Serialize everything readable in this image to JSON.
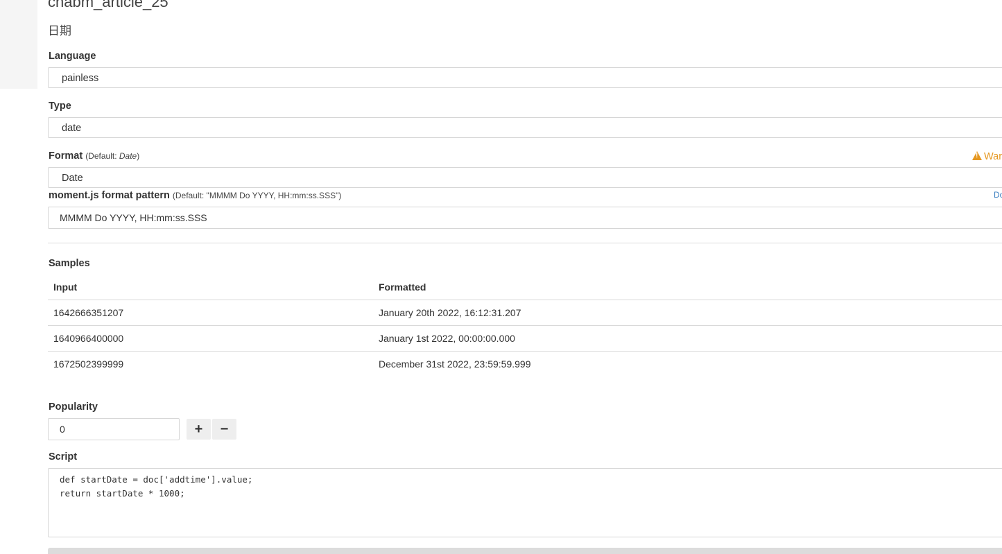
{
  "field": {
    "name": "chabm_article_25",
    "custom_label": "日期"
  },
  "language": {
    "label": "Language",
    "value": "painless"
  },
  "type": {
    "label": "Type",
    "value": "date"
  },
  "format": {
    "label": "Format",
    "default_prefix": "(Default: ",
    "default_value": "Date",
    "default_suffix": ")",
    "value": "Date",
    "warning_text": "War"
  },
  "pattern": {
    "label": "moment.js format pattern",
    "default_hint": "(Default: \"MMMM Do YYYY, HH:mm:ss.SSS\")",
    "docs_link": "Do",
    "value": "MMMM Do YYYY, HH:mm:ss.SSS"
  },
  "samples": {
    "label": "Samples",
    "headers": [
      "Input",
      "Formatted"
    ],
    "rows": [
      [
        "1642666351207",
        "January 20th 2022, 16:12:31.207"
      ],
      [
        "1640966400000",
        "January 1st 2022, 00:00:00.000"
      ],
      [
        "1672502399999",
        "December 31st 2022, 23:59:59.999"
      ]
    ]
  },
  "popularity": {
    "label": "Popularity",
    "value": "0",
    "increment_label": "+",
    "decrement_label": "−"
  },
  "script": {
    "label": "Script",
    "code": "def startDate = doc['addtime'].value;\nreturn startDate * 1000;"
  },
  "colors": {
    "warning": "#e5971f",
    "link": "#3a7fc1",
    "border": "#d6d6d6"
  }
}
